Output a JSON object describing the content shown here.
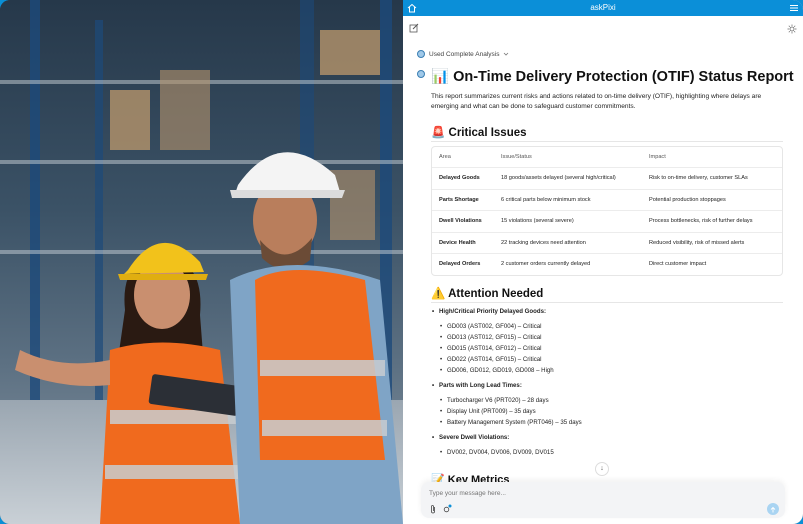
{
  "app": {
    "title": "askPixi"
  },
  "analysis": {
    "label": "Used Complete Analysis"
  },
  "report": {
    "title": "On-Time Delivery Protection (OTIF) Status Report",
    "intro": "This report summarizes current risks and actions related to on-time delivery (OTIF), highlighting where delays are emerging and what can be done to safeguard customer commitments."
  },
  "critical": {
    "heading": "Critical Issues",
    "headers": [
      "Area",
      "Issue/Status",
      "Impact"
    ],
    "rows": [
      [
        "Delayed Goods",
        "18 goods/assets delayed (several high/critical)",
        "Risk to on-time delivery, customer SLAs"
      ],
      [
        "Parts Shortage",
        "6 critical parts below minimum stock",
        "Potential production stoppages"
      ],
      [
        "Dwell Violations",
        "15 violations (several severe)",
        "Process bottlenecks, risk of further delays"
      ],
      [
        "Device Health",
        "22 tracking devices need attention",
        "Reduced visibility, risk of missed alerts"
      ],
      [
        "Delayed Orders",
        "2 customer orders currently delayed",
        "Direct customer impact"
      ]
    ]
  },
  "attention": {
    "heading": "Attention Needed",
    "groups": [
      {
        "title": "High/Critical Priority Delayed Goods:",
        "items": [
          "GD003 (AST002, GF004) – Critical",
          "GD013 (AST012, GF015) – Critical",
          "GD015 (AST014, GF012) – Critical",
          "GD022 (AST014, GF015) – Critical",
          "GD006, GD012, GD019, GD008 – High"
        ]
      },
      {
        "title": "Parts with Long Lead Times:",
        "items": [
          "Turbocharger V6 (PRT020) – 28 days",
          "Display Unit (PRT009) – 35 days",
          "Battery Management System (PRT046) – 35 days"
        ]
      },
      {
        "title": "Severe Dwell Violations:",
        "items": [
          "DV002, DV004, DV006, DV009, DV015"
        ]
      }
    ]
  },
  "metrics": {
    "heading": "Key Metrics"
  },
  "composer": {
    "placeholder": "Type your message here..."
  },
  "icons": [
    "home-icon",
    "menu-icon",
    "edit-icon",
    "sun-icon",
    "chevron-down-icon",
    "bot-icon",
    "chart-icon",
    "siren-icon",
    "warning-icon",
    "memo-icon",
    "arrow-down-icon",
    "paperclip-icon",
    "settings-icon",
    "send-icon"
  ],
  "colors": {
    "titlebar": "#0b8fd8",
    "accent": "#0a8fd6"
  }
}
